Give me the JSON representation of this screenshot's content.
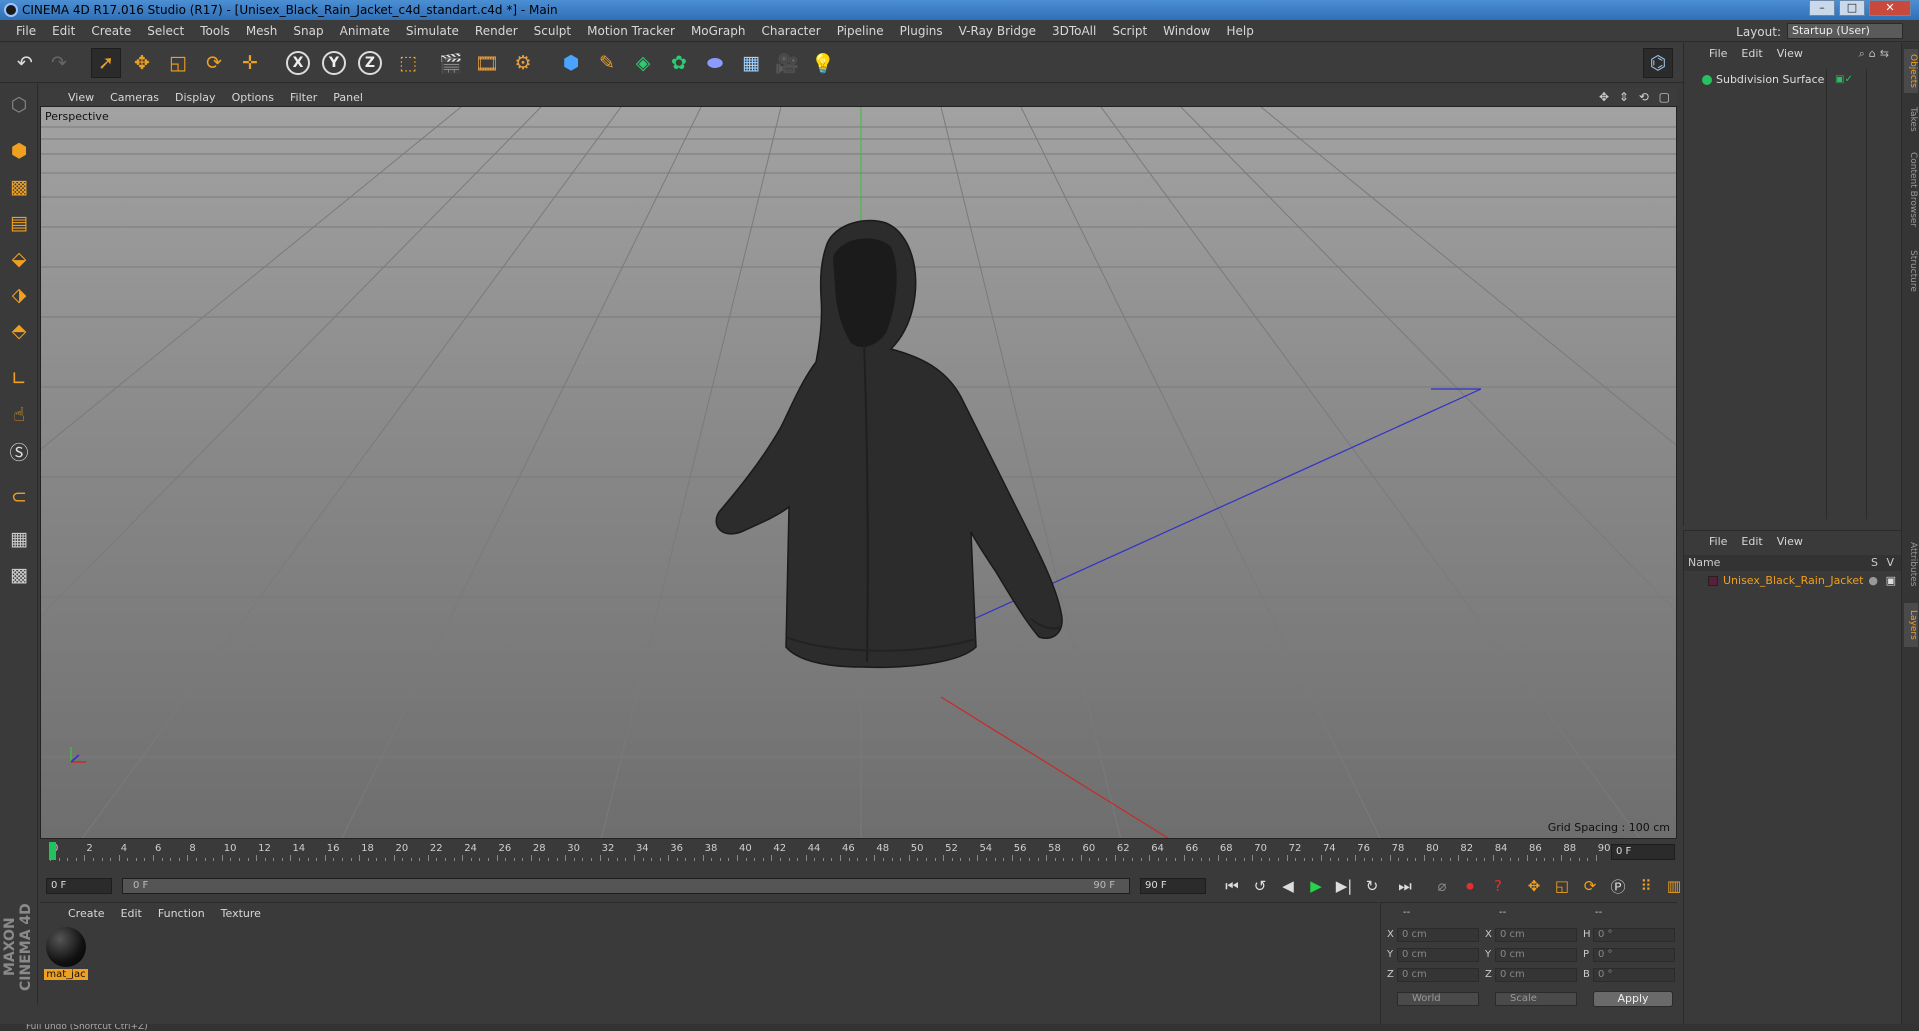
{
  "window": {
    "title": "CINEMA 4D R17.016 Studio (R17) - [Unisex_Black_Rain_Jacket_c4d_standart.c4d *] - Main",
    "minimize": "–",
    "maximize": "□",
    "close": "✕"
  },
  "menubar": {
    "items": [
      "File",
      "Edit",
      "Create",
      "Select",
      "Tools",
      "Mesh",
      "Snap",
      "Animate",
      "Simulate",
      "Render",
      "Sculpt",
      "Motion Tracker",
      "MoGraph",
      "Character",
      "Pipeline",
      "Plugins",
      "V-Ray Bridge",
      "3DToAll",
      "Script",
      "Window",
      "Help"
    ],
    "layout_label": "Layout:",
    "layout_value": "Startup (User)"
  },
  "toolbar": {
    "axis_x": "X",
    "axis_y": "Y",
    "axis_z": "Z"
  },
  "viewport": {
    "menu": [
      "View",
      "Cameras",
      "Display",
      "Options",
      "Filter",
      "Panel"
    ],
    "label": "Perspective",
    "grid_spacing": "Grid Spacing : 100 cm",
    "nav_icons": "✥ ⇕ ⟲ ▢"
  },
  "timeline": {
    "ticks": [
      "0",
      "2",
      "4",
      "6",
      "8",
      "10",
      "12",
      "14",
      "16",
      "18",
      "20",
      "22",
      "24",
      "26",
      "28",
      "30",
      "32",
      "34",
      "36",
      "38",
      "40",
      "42",
      "44",
      "46",
      "48",
      "50",
      "52",
      "54",
      "56",
      "58",
      "60",
      "62",
      "64",
      "66",
      "68",
      "70",
      "72",
      "74",
      "76",
      "78",
      "80",
      "82",
      "84",
      "86",
      "88",
      "90"
    ],
    "current_frame": "0 F"
  },
  "transport": {
    "start_field": "0 F",
    "slider_start": "0 F",
    "slider_end": "90 F",
    "end_field": "90 F"
  },
  "material_panel": {
    "menu": [
      "Create",
      "Edit",
      "Function",
      "Texture"
    ],
    "materials": [
      {
        "name": "mat_jac"
      }
    ]
  },
  "coordinates": {
    "headers": [
      "--",
      "--",
      "--"
    ],
    "rows": [
      {
        "a": "X",
        "av": "0 cm",
        "b": "X",
        "bv": "0 cm",
        "c": "H",
        "cv": "0 °"
      },
      {
        "a": "Y",
        "av": "0 cm",
        "b": "Y",
        "bv": "0 cm",
        "c": "P",
        "cv": "0 °"
      },
      {
        "a": "Z",
        "av": "0 cm",
        "b": "Z",
        "bv": "0 cm",
        "c": "B",
        "cv": "0 °"
      }
    ],
    "world": "World",
    "scale": "Scale",
    "apply": "Apply"
  },
  "object_manager": {
    "menu": [
      "File",
      "Edit",
      "View"
    ],
    "objects": [
      {
        "name": "Subdivision Surface"
      }
    ]
  },
  "layer_manager": {
    "menu": [
      "File",
      "Edit",
      "View"
    ],
    "col_name": "Name",
    "col_s": "S",
    "col_v": "V",
    "layers": [
      {
        "name": "Unisex_Black_Rain_Jacket"
      }
    ]
  },
  "side_tabs": [
    "Objects",
    "Takes",
    "Content Browser",
    "Structure",
    "Attributes",
    "Layers"
  ],
  "brand": {
    "line1": "MAXON",
    "line2": "CINEMA 4D"
  },
  "status": {
    "text": "Full undo (Shortcut Ctrl+Z)"
  }
}
